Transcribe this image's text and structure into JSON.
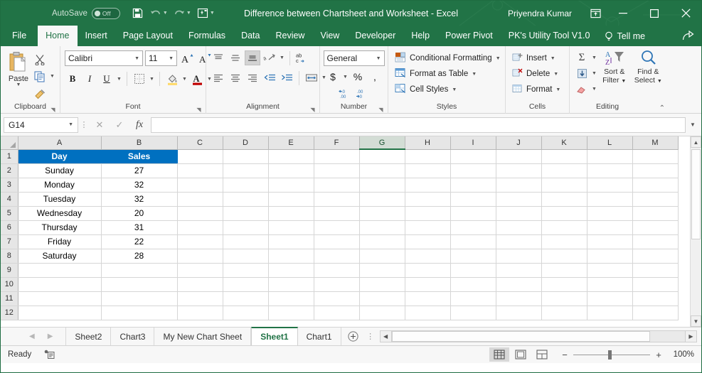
{
  "titlebar": {
    "autosave_label": "AutoSave",
    "autosave_state": "Off",
    "document_title": "Difference between Chartsheet and Worksheet  -  Excel",
    "account_name": "Priyendra Kumar",
    "quick_access": [
      {
        "name": "save-icon",
        "label": "Save"
      },
      {
        "name": "undo-icon",
        "label": "Undo"
      },
      {
        "name": "redo-icon",
        "label": "Redo"
      },
      {
        "name": "touch-mode-icon",
        "label": "Touch/Mouse Mode"
      },
      {
        "name": "customize-qat-icon",
        "label": "Customize Quick Access Toolbar"
      }
    ],
    "window_buttons": [
      "minimize",
      "maximize",
      "close"
    ],
    "ribbon_display_options": "Ribbon Display Options"
  },
  "ribbon_tabs": [
    {
      "label": "File",
      "active": false
    },
    {
      "label": "Home",
      "active": true
    },
    {
      "label": "Insert",
      "active": false
    },
    {
      "label": "Page Layout",
      "active": false
    },
    {
      "label": "Formulas",
      "active": false
    },
    {
      "label": "Data",
      "active": false
    },
    {
      "label": "Review",
      "active": false
    },
    {
      "label": "View",
      "active": false
    },
    {
      "label": "Developer",
      "active": false
    },
    {
      "label": "Help",
      "active": false
    },
    {
      "label": "Power Pivot",
      "active": false
    },
    {
      "label": "PK's Utility Tool V1.0",
      "active": false
    }
  ],
  "tell_me": "Tell me",
  "share_label": "Share",
  "ribbon": {
    "clipboard": {
      "group_label": "Clipboard",
      "paste_label": "Paste",
      "cut_label": "Cut",
      "copy_label": "Copy",
      "format_painter_label": "Format Painter"
    },
    "font": {
      "group_label": "Font",
      "font_name": "Calibri",
      "font_size": "11",
      "grow_font": "A",
      "shrink_font": "A",
      "bold": "B",
      "italic": "I",
      "underline": "U",
      "borders_label": "Borders",
      "fill_color_label": "Fill Color",
      "font_color_label": "Font Color"
    },
    "alignment": {
      "group_label": "Alignment",
      "top_align": "Top Align",
      "middle_align": "Middle Align",
      "bottom_align": "Bottom Align",
      "orientation": "Orientation",
      "align_left": "Align Left",
      "center": "Center",
      "align_right": "Align Right",
      "decrease_indent": "Decrease Indent",
      "increase_indent": "Increase Indent",
      "wrap_text": "ab",
      "merge_center": "Merge & Center"
    },
    "number": {
      "group_label": "Number",
      "format": "General",
      "accounting": "$",
      "percent": "%",
      "comma": ",",
      "increase_decimal": "Increase Decimal",
      "decrease_decimal": "Decrease Decimal"
    },
    "styles": {
      "group_label": "Styles",
      "items": [
        {
          "label": "Conditional Formatting",
          "icon": "conditional-formatting-icon"
        },
        {
          "label": "Format as Table",
          "icon": "format-as-table-icon"
        },
        {
          "label": "Cell Styles",
          "icon": "cell-styles-icon"
        }
      ]
    },
    "cells": {
      "group_label": "Cells",
      "items": [
        {
          "label": "Insert",
          "icon": "insert-cells-icon"
        },
        {
          "label": "Delete",
          "icon": "delete-cells-icon"
        },
        {
          "label": "Format",
          "icon": "format-cells-icon"
        }
      ]
    },
    "editing": {
      "group_label": "Editing",
      "autosum": "Σ",
      "fill_label": "Fill",
      "clear_label": "Clear",
      "sort_filter_line1": "Sort &",
      "sort_filter_line2": "Filter",
      "find_select_line1": "Find &",
      "find_select_line2": "Select"
    },
    "collapse_label": "Collapse the Ribbon"
  },
  "formula_bar": {
    "name_box": "G14",
    "cancel": "Cancel",
    "enter": "Enter",
    "insert_function": "fx",
    "value": "",
    "expand": "Expand Formula Bar"
  },
  "grid": {
    "columns": [
      "A",
      "B",
      "C",
      "D",
      "E",
      "F",
      "G",
      "H",
      "I",
      "J",
      "K",
      "L",
      "M"
    ],
    "active_column": "G",
    "rows": [
      "1",
      "2",
      "3",
      "4",
      "5",
      "6",
      "7",
      "8",
      "9",
      "10",
      "11",
      "12"
    ],
    "header_row": {
      "A": "Day",
      "B": "Sales"
    },
    "data": [
      {
        "row": "2",
        "A": "Sunday",
        "B": "27"
      },
      {
        "row": "3",
        "A": "Monday",
        "B": "32"
      },
      {
        "row": "4",
        "A": "Tuesday",
        "B": "32"
      },
      {
        "row": "5",
        "A": "Wednesday",
        "B": "20"
      },
      {
        "row": "6",
        "A": "Thursday",
        "B": "31"
      },
      {
        "row": "7",
        "A": "Friday",
        "B": "22"
      },
      {
        "row": "8",
        "A": "Saturday",
        "B": "28"
      },
      {
        "row": "9",
        "A": "",
        "B": ""
      },
      {
        "row": "10",
        "A": "",
        "B": ""
      },
      {
        "row": "11",
        "A": "",
        "B": ""
      },
      {
        "row": "12",
        "A": "",
        "B": ""
      }
    ],
    "header_bg": "#0070c0",
    "header_fg": "#ffffff"
  },
  "sheet_tabs": {
    "tabs": [
      {
        "label": "Sheet2",
        "active": false
      },
      {
        "label": "Chart3",
        "active": false
      },
      {
        "label": "My New Chart Sheet",
        "active": false
      },
      {
        "label": "Sheet1",
        "active": true
      },
      {
        "label": "Chart1",
        "active": false
      }
    ],
    "add_sheet": "+",
    "prev_label": "Previous Sheet",
    "next_label": "Next Sheet"
  },
  "statusbar": {
    "mode": "Ready",
    "accessibility_icon": "accessibility-checker-icon",
    "views": [
      {
        "name": "normal-view",
        "active": true
      },
      {
        "name": "page-layout-view",
        "active": false
      },
      {
        "name": "page-break-preview",
        "active": false
      }
    ],
    "zoom_out": "−",
    "zoom_in": "+",
    "zoom_level": "100%"
  },
  "theme": {
    "excel_green": "#217346",
    "header_blue": "#0070c0",
    "ribbon_bg": "#f7f7f7"
  }
}
